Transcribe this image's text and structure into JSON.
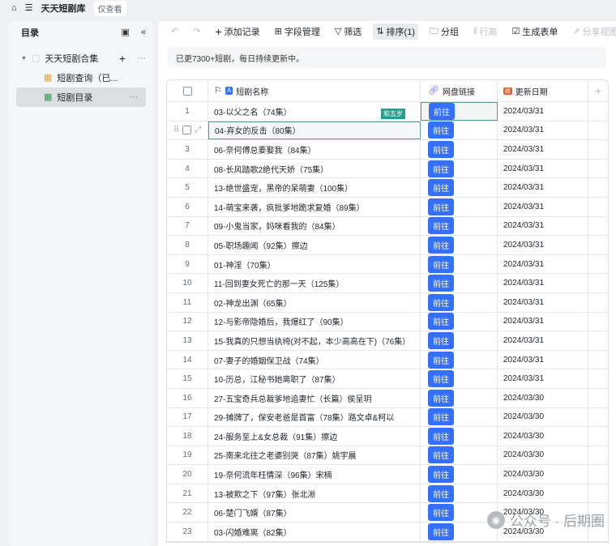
{
  "topbar": {
    "title": "天天短剧库",
    "mode_badge": "仅查看"
  },
  "sidebar": {
    "title": "目录",
    "items": [
      {
        "label": "天天短剧合集"
      },
      {
        "label": "短剧查询（已..."
      },
      {
        "label": "短剧目录"
      }
    ]
  },
  "toolbar": {
    "add_record": "添加记录",
    "fields": "字段管理",
    "filter": "筛选",
    "sort": "排序(1)",
    "group": "分组",
    "row_height": "行高",
    "form": "生成表单",
    "share": "分享视图"
  },
  "notice": "已更7300+短剧，每日持续更新中。",
  "table": {
    "columns": {
      "name": "短剧名称",
      "link": "网盘链接",
      "date": "更新日期"
    },
    "link_label": "前往",
    "cell_tag": "和五岁",
    "rows": [
      {
        "n": "1",
        "name": "03-以父之名（74集）",
        "date": "2024/03/31"
      },
      {
        "n": "2",
        "name": "04-弃女的反击（80集）",
        "date": "2024/03/31"
      },
      {
        "n": "3",
        "name": "06-奈何傅总要娶我（84集）",
        "date": "2024/03/31"
      },
      {
        "n": "4",
        "name": "08-长风踏歌2绝代天娇（75集）",
        "date": "2024/03/31"
      },
      {
        "n": "5",
        "name": "13-绝世盛宠，黑帝的呆萌妻（100集）",
        "date": "2024/03/31"
      },
      {
        "n": "6",
        "name": "14-萌宝来袭，疯批爹地跪求复婚（89集）",
        "date": "2024/03/31"
      },
      {
        "n": "7",
        "name": "09-小鬼当家，妈咪看我的（84集）",
        "date": "2024/03/31"
      },
      {
        "n": "8",
        "name": "05-职场趣闻（92集）擦边",
        "date": "2024/03/31"
      },
      {
        "n": "9",
        "name": "01-神淫（70集）",
        "date": "2024/03/31"
      },
      {
        "n": "10",
        "name": "11-回到妻女死亡的那一天（125集）",
        "date": "2024/03/31"
      },
      {
        "n": "11",
        "name": "02-神龙出渊（65集）",
        "date": "2024/03/31"
      },
      {
        "n": "12",
        "name": "12-与影帝隐婚后，我爆红了（90集）",
        "date": "2024/03/31"
      },
      {
        "n": "13",
        "name": "15-我真的只想当纨绔(对不起，本少高高在下)（76集）",
        "date": "2024/03/31"
      },
      {
        "n": "14",
        "name": "07-妻子的婚姻保卫战（74集）",
        "date": "2024/03/31"
      },
      {
        "n": "15",
        "name": "10-历总，江秘书她离职了（87集）",
        "date": "2024/03/31"
      },
      {
        "n": "16",
        "name": "27-五宝奇兵总裁爹地追妻忙（长篇）侯呈玥",
        "date": "2024/03/30"
      },
      {
        "n": "17",
        "name": "29-摊牌了，保安老爸是首富（78集）路文卓&柯以",
        "date": "2024/03/30"
      },
      {
        "n": "18",
        "name": "24-服务至上&女总裁（91集）擦边",
        "date": "2024/03/30"
      },
      {
        "n": "19",
        "name": "25-南来北往之老婆别哭（87集）姚宇晨",
        "date": "2024/03/30"
      },
      {
        "n": "20",
        "name": "19-奈何流年枉情深（96集）宋楠",
        "date": "2024/03/30"
      },
      {
        "n": "21",
        "name": "13-被欺之下（97集）张北淅",
        "date": "2024/03/30"
      },
      {
        "n": "22",
        "name": "06-楚门飞婿（87集）",
        "date": "2024/03/30"
      },
      {
        "n": "23",
        "name": "03-闪婚难离（82集）",
        "date": "2024/03/30"
      }
    ]
  },
  "watermark": "公众号 · 后期圈",
  "colors": {
    "accent": "#3370ff",
    "selection": "#5a9a94"
  }
}
